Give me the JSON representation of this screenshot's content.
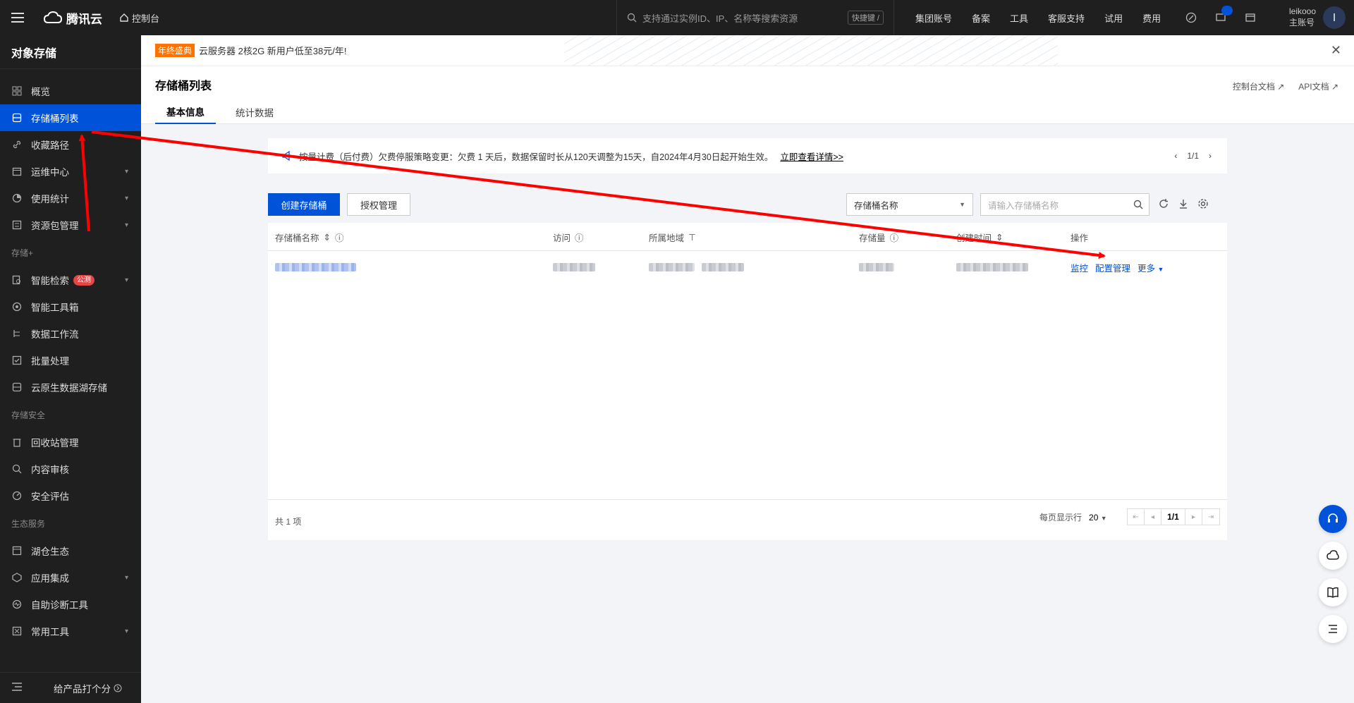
{
  "topbar": {
    "brand": "腾讯云",
    "console": "控制台",
    "search_placeholder": "支持通过实例ID、IP、名称等搜索资源",
    "shortcut": "快捷键 /",
    "nav": [
      "集团账号",
      "备案",
      "工具",
      "客服支持",
      "试用",
      "费用"
    ],
    "user_name": "leikooo",
    "user_role": "主账号",
    "avatar_letter": "l"
  },
  "sidebar": {
    "title": "对象存储",
    "items": [
      {
        "label": "概览",
        "icon": "dashboard-icon"
      },
      {
        "label": "存储桶列表",
        "icon": "bucket-icon",
        "active": true
      },
      {
        "label": "收藏路径",
        "icon": "link-icon"
      },
      {
        "label": "运维中心",
        "icon": "calendar-icon",
        "expand": true
      },
      {
        "label": "使用统计",
        "icon": "pie-icon",
        "expand": true
      },
      {
        "label": "资源包管理",
        "icon": "package-icon",
        "expand": true
      }
    ],
    "group1": "存储+",
    "items2": [
      {
        "label": "智能检索",
        "icon": "search-doc-icon",
        "tag": "公测",
        "expand": true
      },
      {
        "label": "智能工具箱",
        "icon": "toolbox-icon"
      },
      {
        "label": "数据工作流",
        "icon": "workflow-icon"
      },
      {
        "label": "批量处理",
        "icon": "batch-icon"
      },
      {
        "label": "云原生数据湖存储",
        "icon": "lake-icon"
      }
    ],
    "group2": "存储安全",
    "items3": [
      {
        "label": "回收站管理",
        "icon": "trash-icon"
      },
      {
        "label": "内容审核",
        "icon": "audit-icon"
      },
      {
        "label": "安全评估",
        "icon": "gauge-icon"
      }
    ],
    "group3": "生态服务",
    "items4": [
      {
        "label": "湖仓生态",
        "icon": "warehouse-icon"
      },
      {
        "label": "应用集成",
        "icon": "integration-icon",
        "expand": true
      },
      {
        "label": "自助诊断工具",
        "icon": "diagnose-icon"
      },
      {
        "label": "常用工具",
        "icon": "tools-icon",
        "expand": true
      }
    ],
    "feedback": "给产品打个分"
  },
  "promo": {
    "tag": "年终盛典",
    "text": "云服务器 2核2G 新用户低至38元/年!"
  },
  "page": {
    "title": "存储桶列表",
    "doc1": "控制台文档",
    "doc2": "API文档",
    "tabs": [
      "基本信息",
      "统计数据"
    ]
  },
  "notice": {
    "text": "按量计费（后付费）欠费停服策略变更：欠费 1 天后，数据保留时长从120天调整为15天，自2024年4月30日起开始生效。",
    "link": "立即查看详情>>",
    "page": "1/1"
  },
  "toolbar": {
    "create": "创建存储桶",
    "auth": "授权管理",
    "select": "存储桶名称",
    "search_placeholder": "请输入存储桶名称"
  },
  "table": {
    "headers": [
      "存储桶名称",
      "访问",
      "所属地域",
      "存储量",
      "创建时间",
      "操作"
    ],
    "actions": [
      "监控",
      "配置管理",
      "更多"
    ],
    "total": "共 1 项",
    "per_page_label": "每页显示行",
    "per_page": "20",
    "page": "1/1"
  }
}
